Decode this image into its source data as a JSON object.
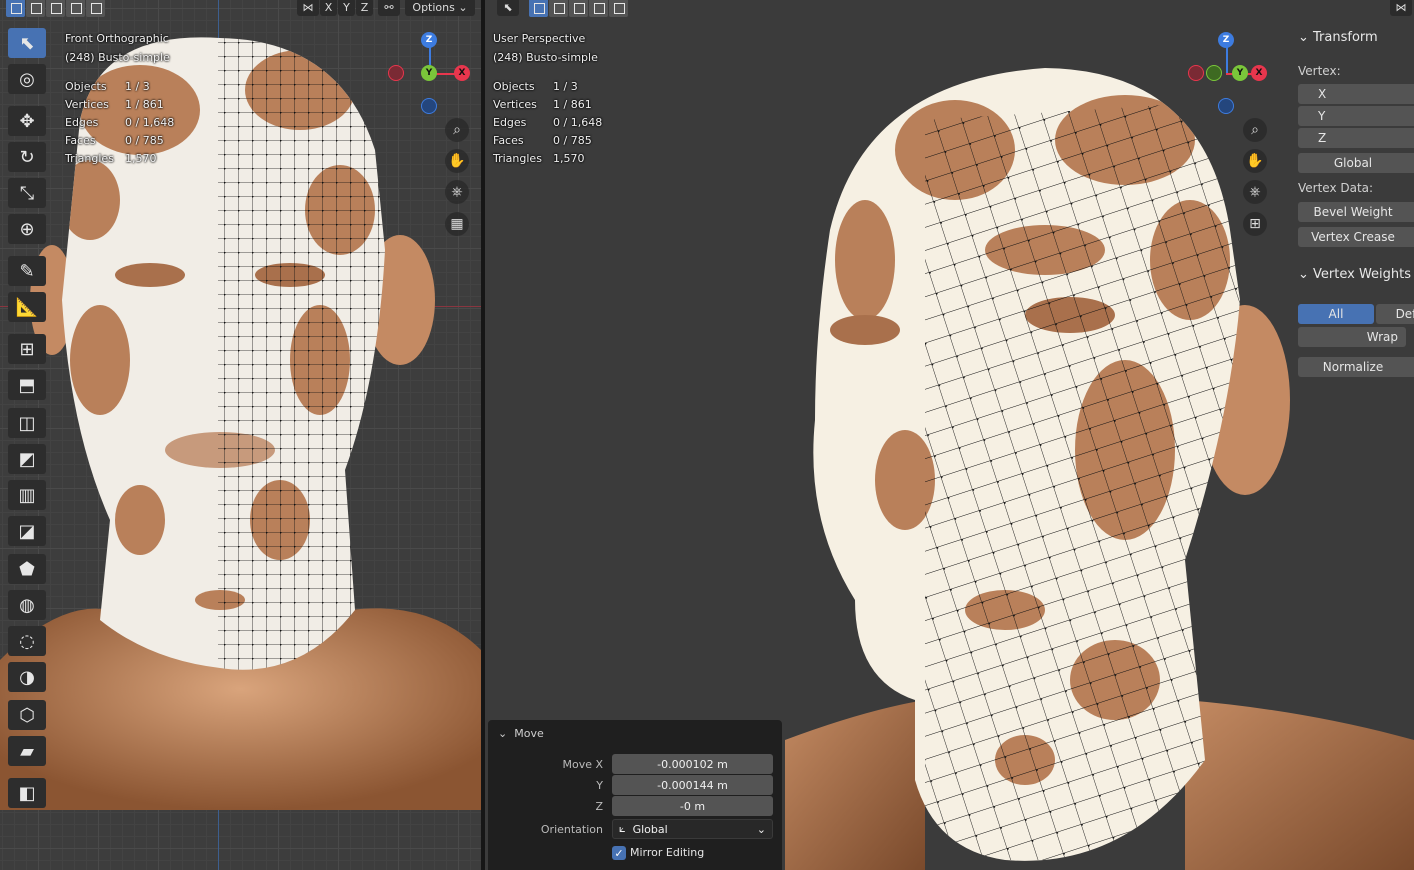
{
  "left_view": {
    "title": "Front Orthographic",
    "object": "(248) Busto-simple",
    "stats": [
      {
        "label": "Objects",
        "value": "1 / 3"
      },
      {
        "label": "Vertices",
        "value": "1 / 861"
      },
      {
        "label": "Edges",
        "value": "0 / 1,648"
      },
      {
        "label": "Faces",
        "value": "0 / 785"
      },
      {
        "label": "Triangles",
        "value": "1,570"
      }
    ],
    "header": {
      "x": "X",
      "y": "Y",
      "z": "Z",
      "options": "Options"
    },
    "gizmo": {
      "z": "Z",
      "y": "Y",
      "x": "X"
    }
  },
  "right_view": {
    "title": "User Perspective",
    "object": "(248) Busto-simple",
    "stats": [
      {
        "label": "Objects",
        "value": "1 / 3"
      },
      {
        "label": "Vertices",
        "value": "1 / 861"
      },
      {
        "label": "Edges",
        "value": "0 / 1,648"
      },
      {
        "label": "Faces",
        "value": "0 / 785"
      },
      {
        "label": "Triangles",
        "value": "1,570"
      }
    ],
    "gizmo": {
      "z": "Z",
      "y": "Y",
      "x": "X"
    }
  },
  "toolbar": {
    "tools": [
      "select-box",
      "cursor",
      "move",
      "rotate",
      "scale",
      "transform",
      "annotate",
      "measure",
      "add-cube",
      "extrude-region",
      "inset-faces",
      "bevel",
      "loop-cut",
      "knife",
      "poly-build",
      "spin",
      "smooth",
      "edge-slide",
      "shrink-fatten",
      "shear",
      "rip-region"
    ]
  },
  "n_panel": {
    "transform": {
      "title": "Transform",
      "vertex_label": "Vertex:",
      "x": "X",
      "y": "Y",
      "z": "Z",
      "space": "Global",
      "vertex_data_label": "Vertex Data:",
      "bevel_weight": "Bevel Weight",
      "vertex_crease": "Vertex Crease"
    },
    "vertex_weights": {
      "title": "Vertex Weights",
      "all": "All",
      "def": "Def",
      "wrap": "Wrap",
      "normalize": "Normalize"
    }
  },
  "operator": {
    "title": "Move",
    "move_x_label": "Move X",
    "move_x": "-0.000102 m",
    "y_label": "Y",
    "y": "-0.000144 m",
    "z_label": "Z",
    "z": "-0 m",
    "orientation_label": "Orientation",
    "orientation": "Global",
    "mirror_editing": "Mirror Editing"
  },
  "colors": {
    "accent": "#4772b3",
    "skin": "#b9805a",
    "white_paint": "#f7f4ec",
    "axis_x": "#e8364d",
    "axis_y": "#7ac63a",
    "axis_z": "#3d7ce0"
  }
}
